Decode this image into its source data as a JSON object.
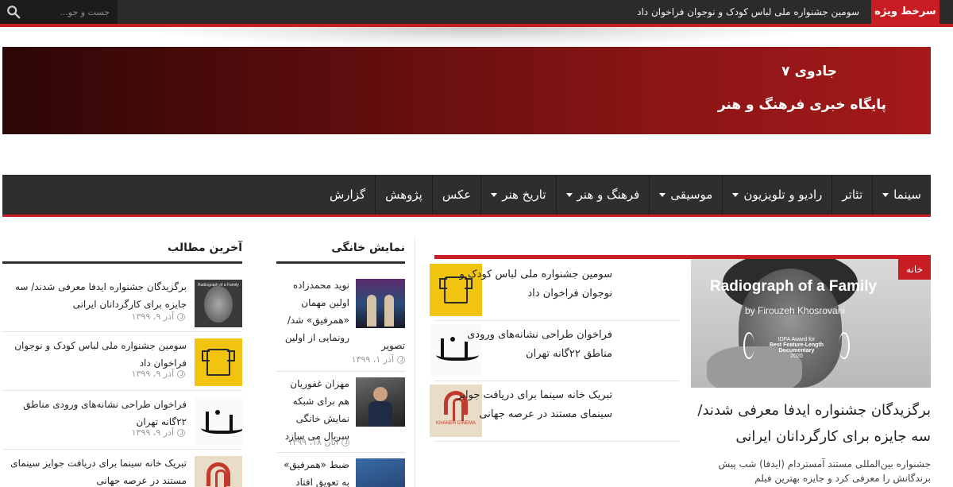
{
  "topbar": {
    "breaking_label": "سرخط ویژه",
    "breaking_text": "سومین جشنواره ملی لباس کودک و نوجوان فراخوان داد",
    "search_placeholder": "جست و جو..."
  },
  "header": {
    "site_name": "جادوی ۷",
    "tagline": "پایگاه خبری فرهنگ و هنر"
  },
  "nav": {
    "items": [
      {
        "label": "سینما",
        "dropdown": true
      },
      {
        "label": "تئاتر",
        "dropdown": false
      },
      {
        "label": "رادیو و تلویزیون",
        "dropdown": true
      },
      {
        "label": "موسیقی",
        "dropdown": true
      },
      {
        "label": "فرهنگ و هنر",
        "dropdown": true
      },
      {
        "label": "تاریخ هنر",
        "dropdown": true
      },
      {
        "label": "عکس",
        "dropdown": false
      },
      {
        "label": "پژوهش",
        "dropdown": false
      },
      {
        "label": "گزارش",
        "dropdown": false
      }
    ]
  },
  "featured": {
    "category": "خانه",
    "image_title_en": "Radiograph of a Family",
    "image_by_en": "by Firouzeh Khosrovani",
    "award_line1": "IDFA Award for",
    "award_line2": "Best Feature-Length Documentary",
    "award_line3": "2020",
    "headline": "برگزیدگان جشنواره ایدفا معرفی شدند/ سه جایزه برای کارگردانان ایرانی",
    "excerpt": "جشنواره بین‌المللی مستند آمستردام (ایدفا) شب پیش برندگانش را معرفی کرد و جایزه بهترین فیلم",
    "list": [
      {
        "title": "سومین جشنواره ملی لباس کودک و نوجوان فراخوان داد",
        "thumb": "yellow"
      },
      {
        "title": "فراخوان طراحی نشانه‌های ورودی مناطق ۲۲گانه تهران",
        "thumb": "callig"
      },
      {
        "title": "تبریک خانه سینما برای دریافت جوایز سینمای مستند در عرصه جهانی",
        "thumb": "cinema",
        "logo_text": "KHANEH CINEMA"
      }
    ]
  },
  "show": {
    "title": "نمایش خانگی",
    "items": [
      {
        "title_top": "نوید محمدزاده اولین مهمان «همرفیق» شد/ رونمایی از اولین",
        "title_rest": "تصویر",
        "date": "آذر ۱، ۱۳۹۹"
      },
      {
        "title": "مهران غفوریان هم برای شبکه نمایش خانگی سریال می سازد",
        "date": "آبان ۱۸، ۱۳۹۹"
      },
      {
        "title": "ضبط «همرفیق» به تعویق افتاد",
        "date": ""
      }
    ]
  },
  "latest": {
    "title": "آخرین مطالب",
    "items": [
      {
        "title": "برگزیدگان جشنواره ایدفا معرفی شدند/ سه جایزه برای کارگردانان ایرانی",
        "date": "آذر ۹، ۱۳۹۹",
        "thumb_text": "Radiograph of a Family"
      },
      {
        "title": "سومین جشنواره ملی لباس کودک و نوجوان فراخوان داد",
        "date": "آذر ۹، ۱۳۹۹"
      },
      {
        "title": "فراخوان طراحی نشانه‌های ورودی مناطق ۲۲گانه تهران",
        "date": "آذر ۹، ۱۳۹۹"
      },
      {
        "title": "تبریک خانه سینما برای دریافت جوایز سینمای مستند در عرصه جهانی",
        "date": ""
      }
    ]
  },
  "colors": {
    "accent_red": "#c71d23",
    "dark_bar": "#2e2e2e"
  }
}
